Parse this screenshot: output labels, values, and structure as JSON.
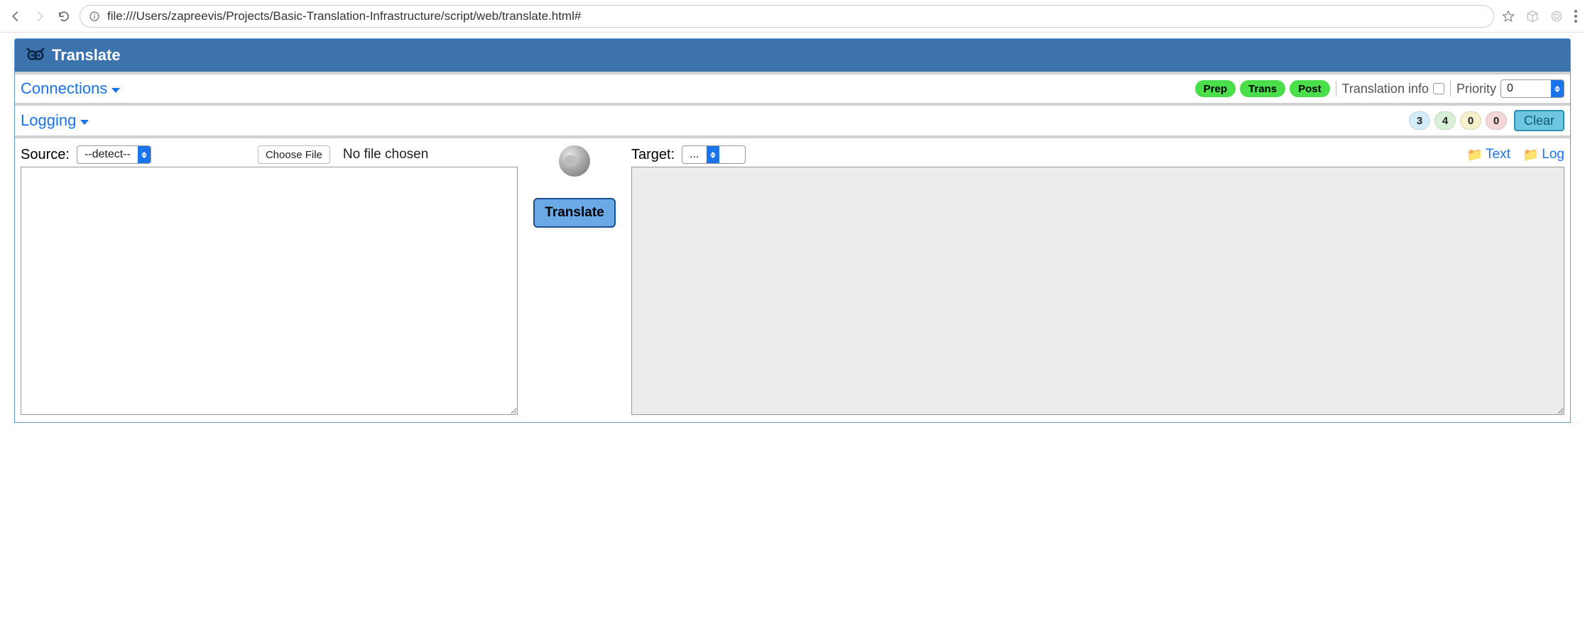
{
  "browser": {
    "url": "file:///Users/zapreevis/Projects/Basic-Translation-Infrastructure/script/web/translate.html#"
  },
  "header": {
    "title": "Translate"
  },
  "connections": {
    "label": "Connections",
    "pills": {
      "prep": "Prep",
      "trans": "Trans",
      "post": "Post"
    },
    "info_label": "Translation info",
    "priority_label": "Priority",
    "priority_value": "0"
  },
  "logging": {
    "label": "Logging",
    "counts": {
      "blue": "3",
      "green": "4",
      "yellow": "0",
      "red": "0"
    },
    "clear_label": "Clear"
  },
  "source": {
    "label": "Source:",
    "lang_value": "--detect--",
    "choose_file_label": "Choose File",
    "file_status": "No file chosen"
  },
  "middle": {
    "translate_label": "Translate"
  },
  "target": {
    "label": "Target:",
    "lang_value": "...",
    "text_link": "Text",
    "log_link": "Log"
  }
}
